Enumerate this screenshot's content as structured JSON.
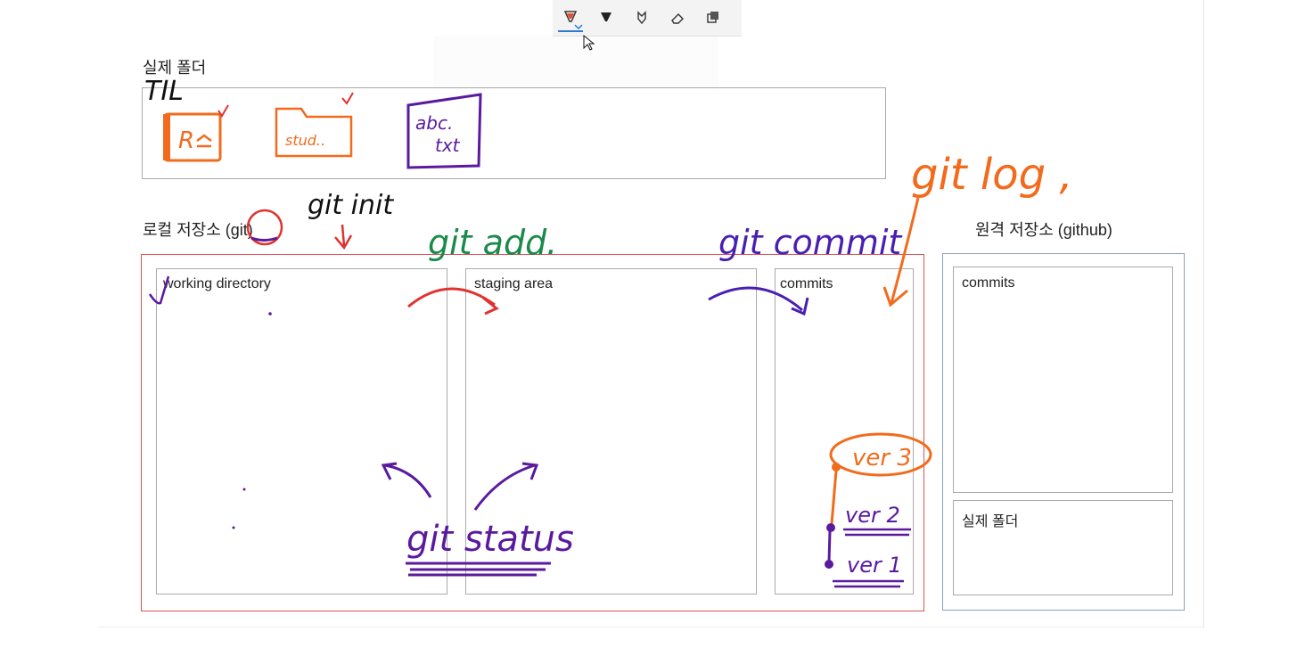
{
  "toolbar": {
    "tools": [
      "highlighter-pen-icon",
      "pen-icon",
      "lasso-icon",
      "eraser-icon",
      "copy-icon"
    ],
    "active_tool": "highlighter-pen-icon",
    "accent": "#2b7bd6"
  },
  "diagram": {
    "real_folder_title": "실제 폴더",
    "local_repo_title": "로컬 저장소 (git)",
    "remote_repo_title": "원격 저장소 (github)",
    "working_directory": "working directory",
    "staging_area": "staging area",
    "commits": "commits",
    "remote_commits": "commits",
    "remote_real_folder": "실제 폴더"
  },
  "annotations": {
    "folder_name": "TIL",
    "file_readme": "R",
    "file_study": "stud..",
    "file_abc_1": "abc.",
    "file_abc_2": "txt",
    "git_init": "git init",
    "git_add": "git add.",
    "git_commit": "git commit",
    "git_log": "git log ,",
    "git_status": "git status",
    "ver3": "ver 3",
    "ver2": "ver 2",
    "ver1": "ver 1"
  },
  "colors": {
    "orange": "#f26b1d",
    "purple": "#5a1a9e",
    "red": "#e0322f",
    "green": "#1a8a4a",
    "local_border": "#d9545a",
    "remote_border": "#8aa2c8"
  }
}
